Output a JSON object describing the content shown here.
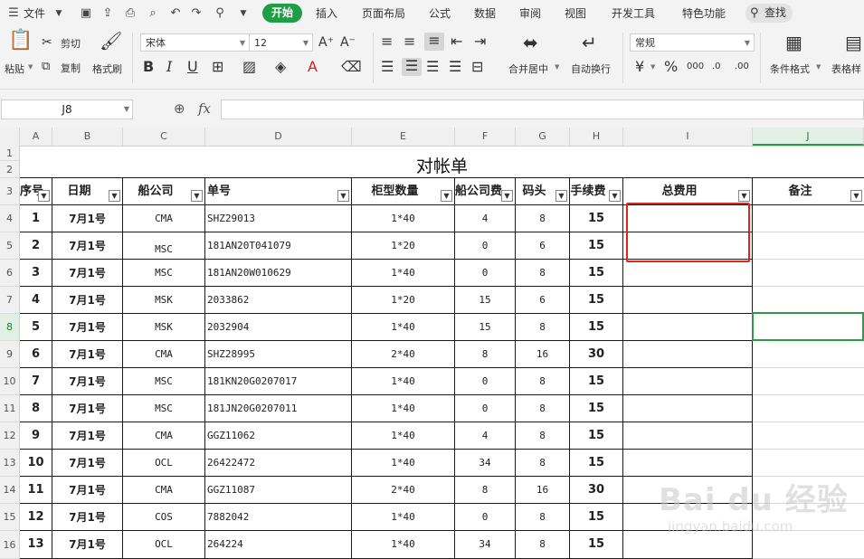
{
  "menu": {
    "file": "文件",
    "tabs": [
      "开始",
      "插入",
      "页面布局",
      "公式",
      "数据",
      "审阅",
      "视图",
      "开发工具",
      "特色功能"
    ],
    "search": "查找"
  },
  "ribbon": {
    "paste": "粘贴",
    "cut": "剪切",
    "copy": "复制",
    "format_painter": "格式刷",
    "font_name": "宋体",
    "font_size": "12",
    "bold": "B",
    "italic": "I",
    "underline": "U",
    "merge_center": "合并居中",
    "wrap_text": "自动换行",
    "number_format": "常规",
    "currency": "¥",
    "percent": "%",
    "thousands": "000",
    "inc_decimal": ".0",
    "dec_decimal": ".00",
    "cond_format": "条件格式",
    "table_style": "表格样"
  },
  "formula_bar": {
    "cell_ref": "J8",
    "fx": "fx",
    "content": ""
  },
  "grid": {
    "columns": [
      "A",
      "B",
      "C",
      "D",
      "E",
      "F",
      "G",
      "H",
      "I",
      "J"
    ],
    "rows": [
      "1",
      "2",
      "3",
      "4",
      "5",
      "6",
      "7",
      "8",
      "9",
      "10",
      "11",
      "12",
      "13",
      "14",
      "15",
      "16"
    ],
    "title": "对帐单",
    "headers": [
      "序号",
      "日期",
      "船公司",
      "单号",
      "柜型数量",
      "船公司费",
      "码头",
      "手续费",
      "总费用",
      "备注"
    ],
    "data": [
      [
        "1",
        "7月1号",
        "CMA",
        "SHZ29013",
        "1*40",
        "4",
        "8",
        "15"
      ],
      [
        "2",
        "7月1号",
        "MSC",
        "181AN20T041079",
        "1*20",
        "0",
        "6",
        "15"
      ],
      [
        "3",
        "7月1号",
        "MSC",
        "181AN20W010629",
        "1*40",
        "0",
        "8",
        "15"
      ],
      [
        "4",
        "7月1号",
        "MSK",
        "2033862",
        "1*20",
        "15",
        "6",
        "15"
      ],
      [
        "5",
        "7月1号",
        "MSK",
        "2032904",
        "1*40",
        "15",
        "8",
        "15"
      ],
      [
        "6",
        "7月1号",
        "CMA",
        "SHZ28995",
        "2*40",
        "8",
        "16",
        "30"
      ],
      [
        "7",
        "7月1号",
        "MSC",
        "181KN20G0207017",
        "1*40",
        "0",
        "8",
        "15"
      ],
      [
        "8",
        "7月1号",
        "MSC",
        "181JN20G0207011",
        "1*40",
        "0",
        "8",
        "15"
      ],
      [
        "9",
        "7月1号",
        "CMA",
        "GGZ11062",
        "1*40",
        "4",
        "8",
        "15"
      ],
      [
        "10",
        "7月1号",
        "OCL",
        "26422472",
        "1*40",
        "34",
        "8",
        "15"
      ],
      [
        "11",
        "7月1号",
        "CMA",
        "GGZ11087",
        "2*40",
        "8",
        "16",
        "30"
      ],
      [
        "12",
        "7月1号",
        "COS",
        "7882042",
        "1*40",
        "0",
        "8",
        "15"
      ],
      [
        "13",
        "7月1号",
        "OCL",
        "264224",
        "1*40",
        "34",
        "8",
        "15"
      ]
    ]
  },
  "watermark": {
    "brand": "Bai du 经验",
    "url": "jingyan.baidu.com"
  }
}
